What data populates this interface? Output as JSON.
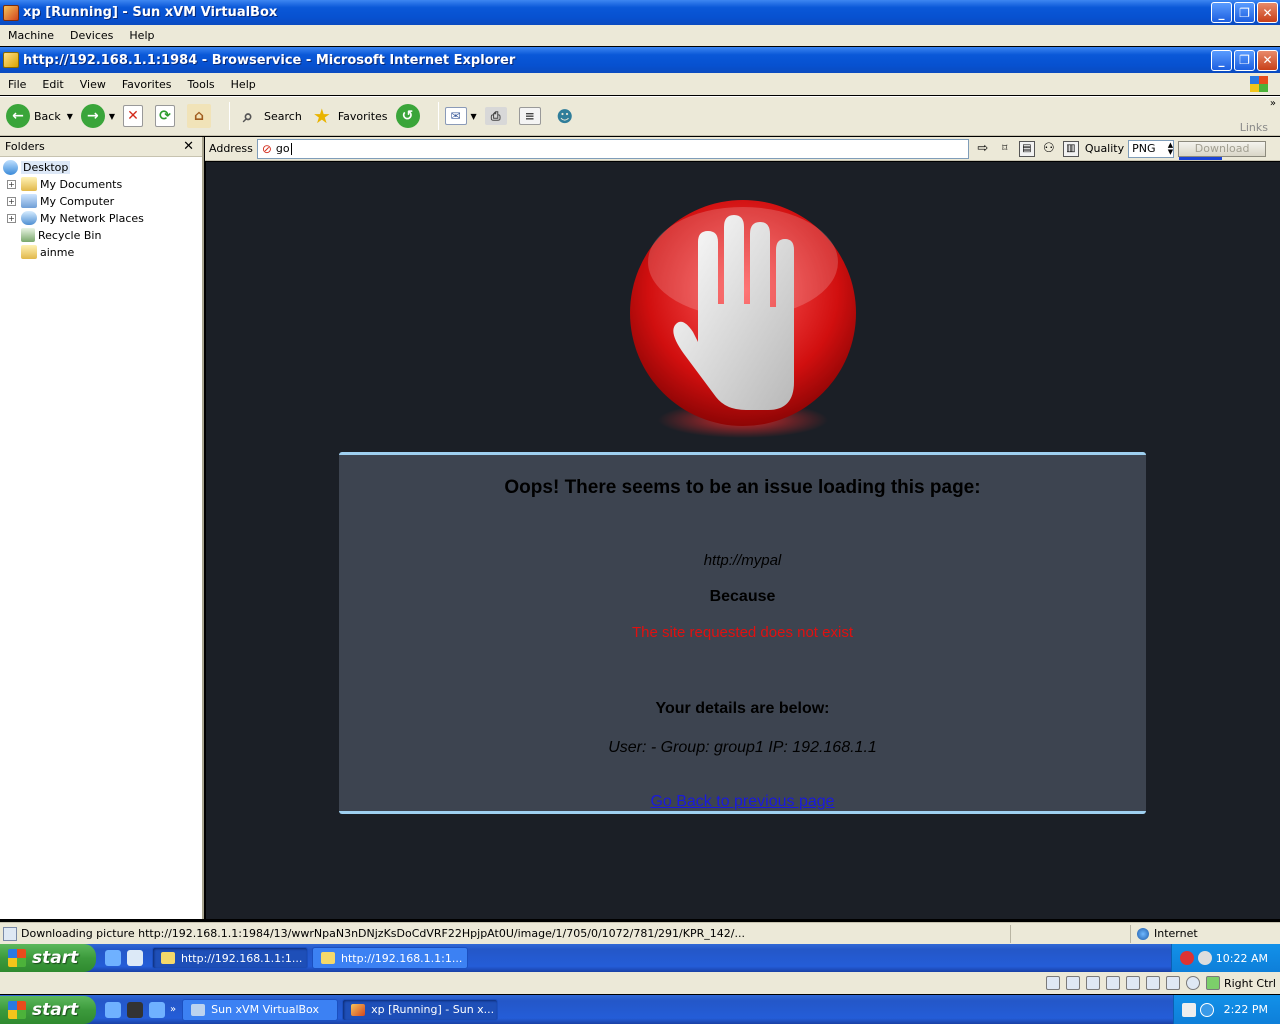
{
  "vbox": {
    "title": "xp [Running] - Sun xVM VirtualBox",
    "menu": [
      "Machine",
      "Devices",
      "Help"
    ],
    "status_right_label": "Right Ctrl"
  },
  "ie": {
    "title": "http://192.168.1.1:1984 - Browservice - Microsoft Internet Explorer",
    "menu": [
      "File",
      "Edit",
      "View",
      "Favorites",
      "Tools",
      "Help"
    ],
    "toolbar": {
      "back": "Back",
      "search": "Search",
      "favorites": "Favorites",
      "links": "Links"
    },
    "folders": {
      "title": "Folders",
      "items": [
        "Desktop",
        "My Documents",
        "My Computer",
        "My Network Places",
        "Recycle Bin",
        "ainme"
      ]
    },
    "address": {
      "label": "Address",
      "value": "go",
      "quality_label": "Quality",
      "quality_value": "PNG",
      "download_label": "Download",
      "download_progress": 0.5
    },
    "status": {
      "text": "Downloading picture http://192.168.1.1:1984/13/wwrNpaN3nDNjzKsDoCdVRF22HpjpAt0U/image/1/705/0/1072/781/291/KPR_142/...",
      "zone": "Internet"
    }
  },
  "page": {
    "heading": "Oops! There seems to be an issue loading this page:",
    "url": "http://mypal",
    "because": "Because",
    "reason": "The site requested does not exist",
    "details_heading": "Your details are below:",
    "user_details": "User: -   Group: group1   IP: 192.168.1.1",
    "back_link": "Go Back to previous page"
  },
  "guest_taskbar": {
    "start": "start",
    "buttons": [
      "http://192.168.1.1:1...",
      "http://192.168.1.1:1..."
    ],
    "clock": "10:22 AM"
  },
  "host_taskbar": {
    "start": "start",
    "buttons": [
      "Sun xVM VirtualBox",
      "xp [Running] - Sun x..."
    ],
    "clock": "2:22 PM"
  },
  "colors": {
    "page_bg": "#1b1f26",
    "panel_bg": "#3d4450",
    "panel_border": "#9fd0f0",
    "reason": "#e01010",
    "link": "#1a1adb"
  }
}
